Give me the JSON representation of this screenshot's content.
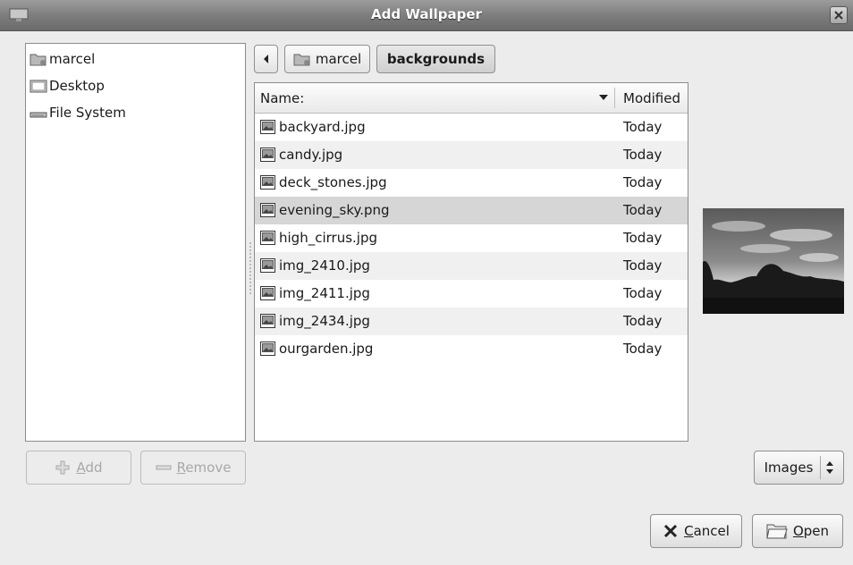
{
  "window": {
    "title": "Add Wallpaper"
  },
  "places": [
    {
      "label": "marcel",
      "icon": "home-folder-icon"
    },
    {
      "label": "Desktop",
      "icon": "desktop-icon"
    },
    {
      "label": "File System",
      "icon": "drive-icon"
    }
  ],
  "pathbar": {
    "back_icon": "left-arrow-icon",
    "crumbs": [
      "marcel",
      "backgrounds"
    ],
    "active": "backgrounds"
  },
  "filelist": {
    "columns": {
      "name": "Name:",
      "modified": "Modified"
    },
    "sort_indicator": "sort-down-icon",
    "files": [
      {
        "name": "backyard.jpg",
        "modified": "Today"
      },
      {
        "name": "candy.jpg",
        "modified": "Today"
      },
      {
        "name": "deck_stones.jpg",
        "modified": "Today"
      },
      {
        "name": "evening_sky.png",
        "modified": "Today"
      },
      {
        "name": "high_cirrus.jpg",
        "modified": "Today"
      },
      {
        "name": "img_2410.jpg",
        "modified": "Today"
      },
      {
        "name": "img_2411.jpg",
        "modified": "Today"
      },
      {
        "name": "img_2434.jpg",
        "modified": "Today"
      },
      {
        "name": "ourgarden.jpg",
        "modified": "Today"
      }
    ],
    "selected": "evening_sky.png"
  },
  "buttons": {
    "add": {
      "mnemonic": "A",
      "rest": "dd"
    },
    "remove": {
      "mnemonic": "R",
      "rest": "emove"
    },
    "cancel": {
      "mnemonic": "C",
      "rest": "ancel"
    },
    "open": {
      "mnemonic": "O",
      "rest": "pen"
    }
  },
  "filter": {
    "selected": "Images"
  },
  "colors": {
    "selection": "#d6d6d6",
    "alt_row": "#f0f0f0",
    "titlebar": "#7e7e7e"
  }
}
